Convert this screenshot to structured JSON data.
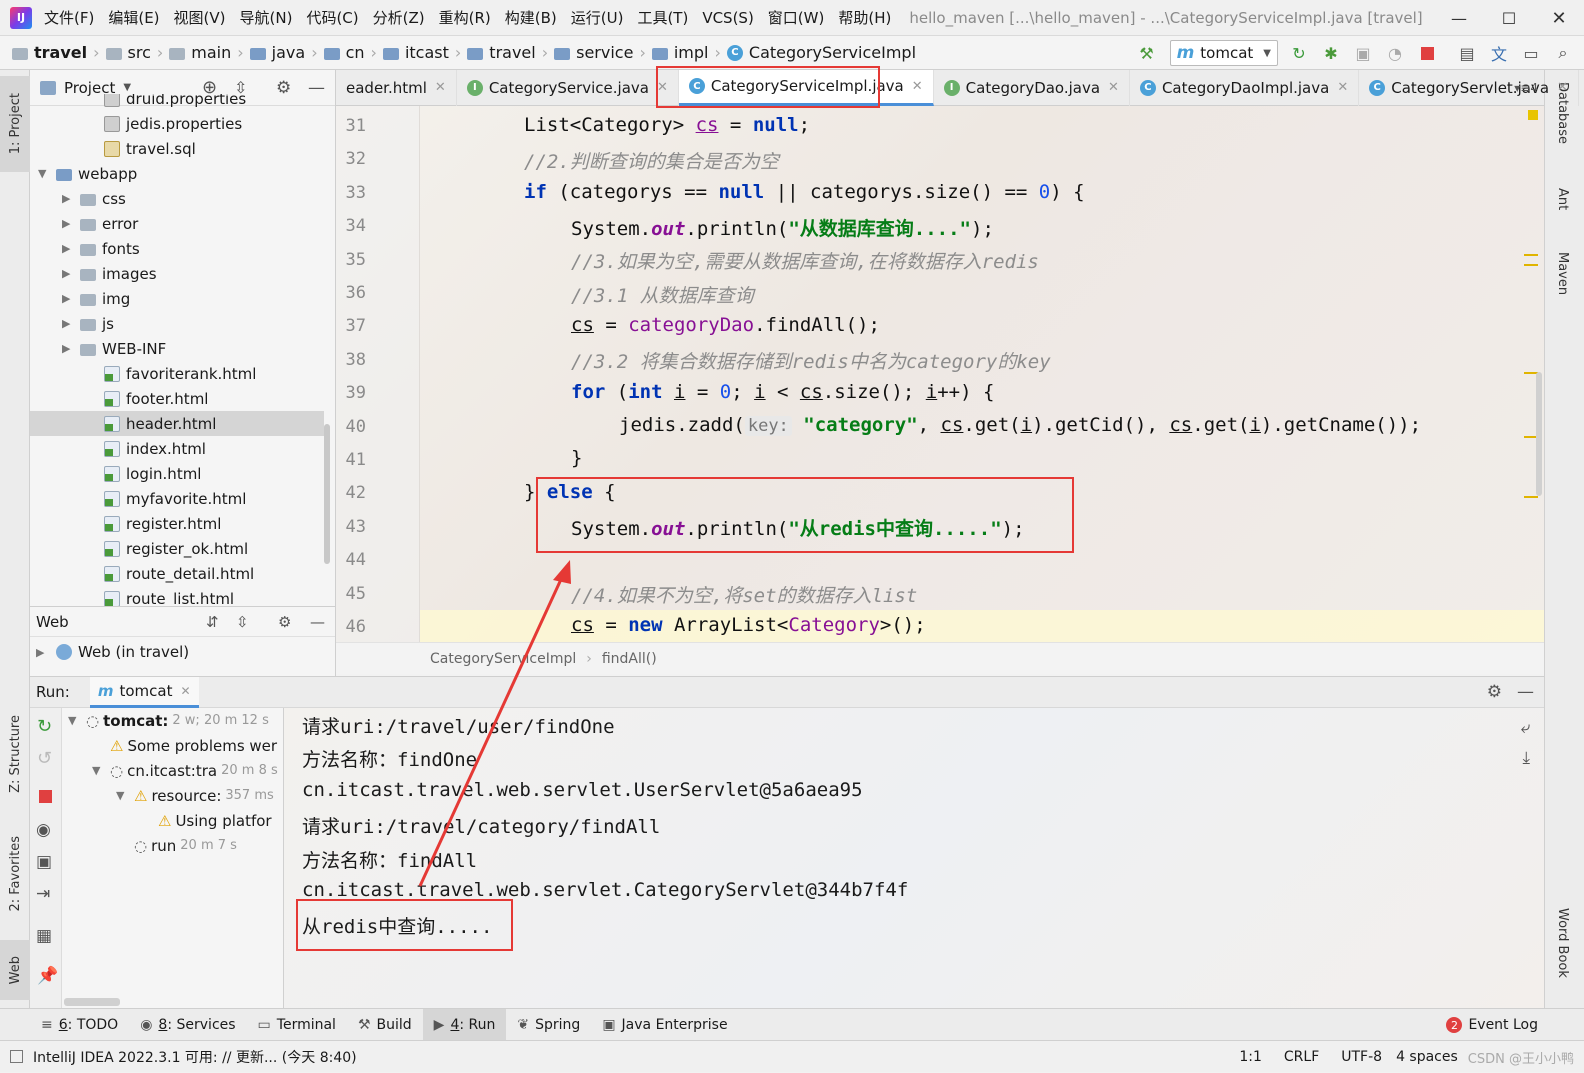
{
  "titlebar": {
    "menus": [
      "文件(F)",
      "编辑(E)",
      "视图(V)",
      "导航(N)",
      "代码(C)",
      "分析(Z)",
      "重构(R)",
      "构建(B)",
      "运行(U)",
      "工具(T)",
      "VCS(S)",
      "窗口(W)",
      "帮助(H)"
    ],
    "window_title": "hello_maven [...\\hello_maven] - ...\\CategoryServiceImpl.java [travel]"
  },
  "breadcrumb": [
    "travel",
    "src",
    "main",
    "java",
    "cn",
    "itcast",
    "travel",
    "service",
    "impl",
    "CategoryServiceImpl"
  ],
  "run_config": "tomcat",
  "left_strip": {
    "project": "1: Project",
    "structure": "Z: Structure",
    "favorites": "2: Favorites",
    "web": "Web"
  },
  "right_strip": {
    "database": "Database",
    "ant": "Ant",
    "maven": "Maven",
    "wordbook": "Word Book"
  },
  "project_panel": {
    "title": "Project",
    "items": [
      {
        "label": "druid.properties",
        "type": "prop",
        "indent": 3
      },
      {
        "label": "jedis.properties",
        "type": "prop",
        "indent": 3
      },
      {
        "label": "travel.sql",
        "type": "sql",
        "indent": 3
      },
      {
        "label": "webapp",
        "type": "folder",
        "indent": 1,
        "expanded": true
      },
      {
        "label": "css",
        "type": "folder",
        "indent": 2
      },
      {
        "label": "error",
        "type": "folder",
        "indent": 2
      },
      {
        "label": "fonts",
        "type": "folder",
        "indent": 2
      },
      {
        "label": "images",
        "type": "folder",
        "indent": 2
      },
      {
        "label": "img",
        "type": "folder",
        "indent": 2
      },
      {
        "label": "js",
        "type": "folder",
        "indent": 2
      },
      {
        "label": "WEB-INF",
        "type": "folder",
        "indent": 2
      },
      {
        "label": "favoriterank.html",
        "type": "html",
        "indent": 3
      },
      {
        "label": "footer.html",
        "type": "html",
        "indent": 3
      },
      {
        "label": "header.html",
        "type": "html",
        "indent": 3,
        "selected": true
      },
      {
        "label": "index.html",
        "type": "html",
        "indent": 3
      },
      {
        "label": "login.html",
        "type": "html",
        "indent": 3
      },
      {
        "label": "myfavorite.html",
        "type": "html",
        "indent": 3
      },
      {
        "label": "register.html",
        "type": "html",
        "indent": 3
      },
      {
        "label": "register_ok.html",
        "type": "html",
        "indent": 3
      },
      {
        "label": "route_detail.html",
        "type": "html",
        "indent": 3
      },
      {
        "label": "route_list.html",
        "type": "html",
        "indent": 3
      }
    ]
  },
  "web_panel": {
    "title": "Web",
    "item": "Web (in travel)"
  },
  "editor_tabs": [
    {
      "label": "eader.html",
      "icon": "html"
    },
    {
      "label": "CategoryService.java",
      "icon": "i"
    },
    {
      "label": "CategoryServiceImpl.java",
      "icon": "c",
      "active": true
    },
    {
      "label": "CategoryDao.java",
      "icon": "i"
    },
    {
      "label": "CategoryDaoImpl.java",
      "icon": "c"
    },
    {
      "label": "CategoryServlet.java",
      "icon": "c"
    }
  ],
  "tab_overflow": "4",
  "editor": {
    "line_numbers": [
      "31",
      "32",
      "33",
      "34",
      "35",
      "36",
      "37",
      "38",
      "39",
      "40",
      "41",
      "42",
      "43",
      "44",
      "45",
      "46"
    ],
    "code_text": {
      "l31a": "List<Category> ",
      "l31b": "cs",
      "l31c": " = ",
      "l31d": "null",
      "l31e": ";",
      "l32": "//2.判断查询的集合是否为空",
      "l33a": "if",
      "l33b": " (categorys == ",
      "l33c": "null",
      "l33d": " || categorys.size() == ",
      "l33e": "0",
      "l33f": ") {",
      "l34a": "System.",
      "l34b": "out",
      "l34c": ".println(",
      "l34d": "\"从数据库查询....\"",
      "l34e": ");",
      "l35": "//3.如果为空,需要从数据库查询,在将数据存入redis",
      "l36": "//3.1 从数据库查询",
      "l37a": "cs",
      "l37b": " = ",
      "l37c": "categoryDao",
      "l37d": ".findAll();",
      "l38": "//3.2 将集合数据存储到redis中名为category的key",
      "l39a": "for",
      "l39b": " (",
      "l39c": "int",
      "l39d": " ",
      "l39e": "i",
      "l39f": " = ",
      "l39g": "0",
      "l39h": "; ",
      "l39i": "i",
      "l39j": " < ",
      "l39k": "cs",
      "l39l": ".size(); ",
      "l39m": "i",
      "l39n": "++) {",
      "l40a": "jedis.zadd(",
      "l40hint": "key:",
      "l40b": "\"category\"",
      "l40c": ", ",
      "l40d": "cs",
      "l40e": ".get(",
      "l40f": "i",
      "l40g": ").getCid(), ",
      "l40h": "cs",
      "l40i": ".get(",
      "l40j": "i",
      "l40k": ").getCname());",
      "l41": "}",
      "l42a": "} ",
      "l42b": "else",
      "l42c": " {",
      "l43a": "System.",
      "l43b": "out",
      "l43c": ".println(",
      "l43d": "\"从redis中查询.....\"",
      "l43e": ");",
      "l45": "//4.如果不为空,将set的数据存入list",
      "l46a": "cs",
      "l46b": " = ",
      "l46c": "new",
      "l46d": " ArrayList<",
      "l46e": "Category",
      "l46f": ">();"
    },
    "breadcrumb": [
      "CategoryServiceImpl",
      "findAll()"
    ]
  },
  "run_panel": {
    "label": "Run:",
    "tab": "tomcat",
    "tree": [
      {
        "label": "tomcat:",
        "time": "2 w; 20 m 12 s",
        "indent": 0
      },
      {
        "label": "Some problems wer",
        "time": "",
        "indent": 1,
        "warn": true
      },
      {
        "label": "cn.itcast:tra",
        "time": "20 m 8 s",
        "indent": 1
      },
      {
        "label": "resource:",
        "time": "357 ms",
        "indent": 2,
        "warn": true
      },
      {
        "label": "Using platfor",
        "time": "",
        "indent": 3,
        "warn": true
      },
      {
        "label": "run",
        "time": "20 m 7 s",
        "indent": 2
      }
    ],
    "console": [
      "请求uri:/travel/user/findOne",
      "方法名称：findOne",
      "cn.itcast.travel.web.servlet.UserServlet@5a6aea95",
      "请求uri:/travel/category/findAll",
      "方法名称：findAll",
      "cn.itcast.travel.web.servlet.CategoryServlet@344b7f4f",
      "从redis中查询....."
    ]
  },
  "bottom_tabs": [
    {
      "num": "6",
      "label": ": TODO"
    },
    {
      "num": "8",
      "label": ": Services"
    },
    {
      "num": "",
      "label": "Terminal"
    },
    {
      "num": "",
      "label": "Build"
    },
    {
      "num": "4",
      "label": ": Run",
      "active": true
    },
    {
      "num": "",
      "label": "Spring"
    },
    {
      "num": "",
      "label": "Java Enterprise"
    }
  ],
  "event_log": {
    "count": "2",
    "label": "Event Log"
  },
  "status": {
    "message": "IntelliJ IDEA 2022.3.1 可用: // 更新... (今天 8:40)",
    "position": "1:1",
    "line_sep": "CRLF",
    "encoding": "UTF-8",
    "indent": "4 spaces"
  },
  "watermark": "CSDN @王小小鸭",
  "colors": {
    "accent": "#4a8fd8",
    "highlight_box": "#e53935",
    "keyword": "#0033b3",
    "string": "#067d17",
    "comment": "#8c8c8c"
  }
}
